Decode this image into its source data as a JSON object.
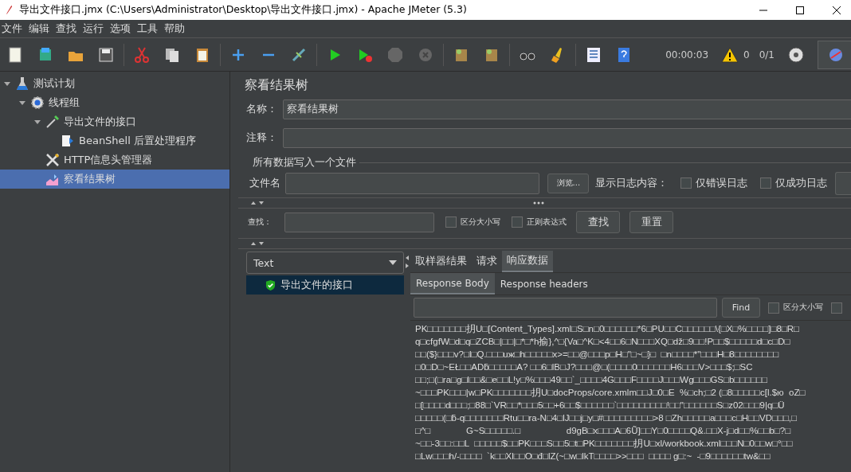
{
  "window": {
    "title": "导出文件接口.jmx (C:\\Users\\Administrator\\Desktop\\导出文件接口.jmx) - Apache JMeter (5.3)"
  },
  "menu": [
    "文件",
    "编辑",
    "查找",
    "运行",
    "选项",
    "工具",
    "帮助"
  ],
  "toolbar": {
    "timer": "00:00:03",
    "warnings": "0",
    "threads": "0/1"
  },
  "tree": [
    {
      "label": "测试计划",
      "kind": "plan",
      "expanded": true,
      "selected": false,
      "children": [
        {
          "label": "线程组",
          "kind": "group",
          "expanded": true,
          "selected": false,
          "children": [
            {
              "label": "导出文件的接口",
              "kind": "sampler",
              "expanded": true,
              "selected": false,
              "children": [
                {
                  "label": "BeanShell 后置处理程序",
                  "kind": "script",
                  "selected": false
                }
              ]
            },
            {
              "label": "HTTP信息头管理器",
              "kind": "tools",
              "selected": false
            },
            {
              "label": "察看结果树",
              "kind": "listener",
              "selected": true
            }
          ]
        }
      ]
    }
  ],
  "panel": {
    "title": "察看结果树",
    "name_label": "名称：",
    "name_value": "察看结果树",
    "comment_label": "注释：",
    "file_section": "所有数据写入一个文件",
    "file_label": "文件名",
    "browse": "浏览...",
    "log_label": "显示日志内容：",
    "log_options": [
      {
        "label": "仅错误日志",
        "checked": false
      },
      {
        "label": "仅成功日志",
        "checked": false
      }
    ],
    "search_label": "查找：",
    "search_options": [
      {
        "label": "区分大小写",
        "checked": false
      },
      {
        "label": "正则表达式",
        "checked": false
      }
    ],
    "search_button": "查找",
    "reset_button": "重置"
  },
  "results": {
    "renderer": "Text",
    "items": [
      {
        "label": "导出文件的接口",
        "selected": true
      }
    ],
    "tabs": [
      {
        "label": "取样器结果",
        "selected": false
      },
      {
        "label": "请求",
        "selected": false
      },
      {
        "label": "响应数据",
        "selected": true
      }
    ],
    "subtabs": [
      {
        "label": "Response Body",
        "selected": true
      },
      {
        "label": "Response headers",
        "selected": false
      }
    ],
    "find_button": "Find",
    "find_options": [
      {
        "label": "区分大小写",
        "checked": false
      },
      {
        "checked": false
      }
    ],
    "body": [
      "PK□□□□□□□抈U□[Content_Types].xml□S□n□0□□□□□□*6□PU□□C□□□□□□\\{□X□%□□□□]□8□R□",
      "q□cfgfW□d□q□ZCB□|□□|□*□*h揄},^□{Va□^K□<4□□6□N□□□XQ□dž□9□□!P□□$□□□□□d□c□D□",
      "□□($}□□□v?□l□Q.□□□uж□h□□□□□x>=□□@□□□p□H□\"□~□}□  □n□□□□*\"□□□H□8□□□□□□□□",
      "□0□D□~EŁ□□ADƃ□□□□□A? □□6□lB□J?□□□@□(□□□□0□□□□□□H6□□□V>□□□$;□SC",
      "□□;□(□ra□g□l□□&□e□□L!y□%□□□49□□`_□□□□4G□□□F□□□□J□□□Wg□□□GS□b□□□□□□",
      "~□□□PK□□□|w□PK□□□□□□□抈U□docProps/core.xmlm□□J□0□E  %□ch;□2 (□8□□□□□c[l.$ю  oZ□",
      "□[□□□□d□□□;□88□`VR□□*□□□5□□+6□□$□□□□□□`□□□□□□□□□!□□\"□□□□□□S□z02□□□9|q□Ü",
      "□□□□□(□ƃ-q□□□□□□□Rtu□□ra-N□4□lJ□□j□y□#□□□□□□□□□>8 □Zh□□□□□a□□□c□H□□VD□□□,□",
      "□^□              G~S□□□□□.□                  d9gB□x□□□A□6Ũ]□□Y□0□□□□Q&.□□X-j□d□□%□□b□?□",
      "~□□-3□□:□□L  □□□□□$□□PK□□□S□□5□t□PK□□□□□□□抈U□xl/workbook.xml□□□N□0□□w□°□□",
      "□Lw□□□h/-□□□□  `k□□Xl□□O□đ□lZ(~□w□lkT□□□□>>□□□  □□□□ g□:~  -□9□□□□□□tw&□□"
    ]
  }
}
